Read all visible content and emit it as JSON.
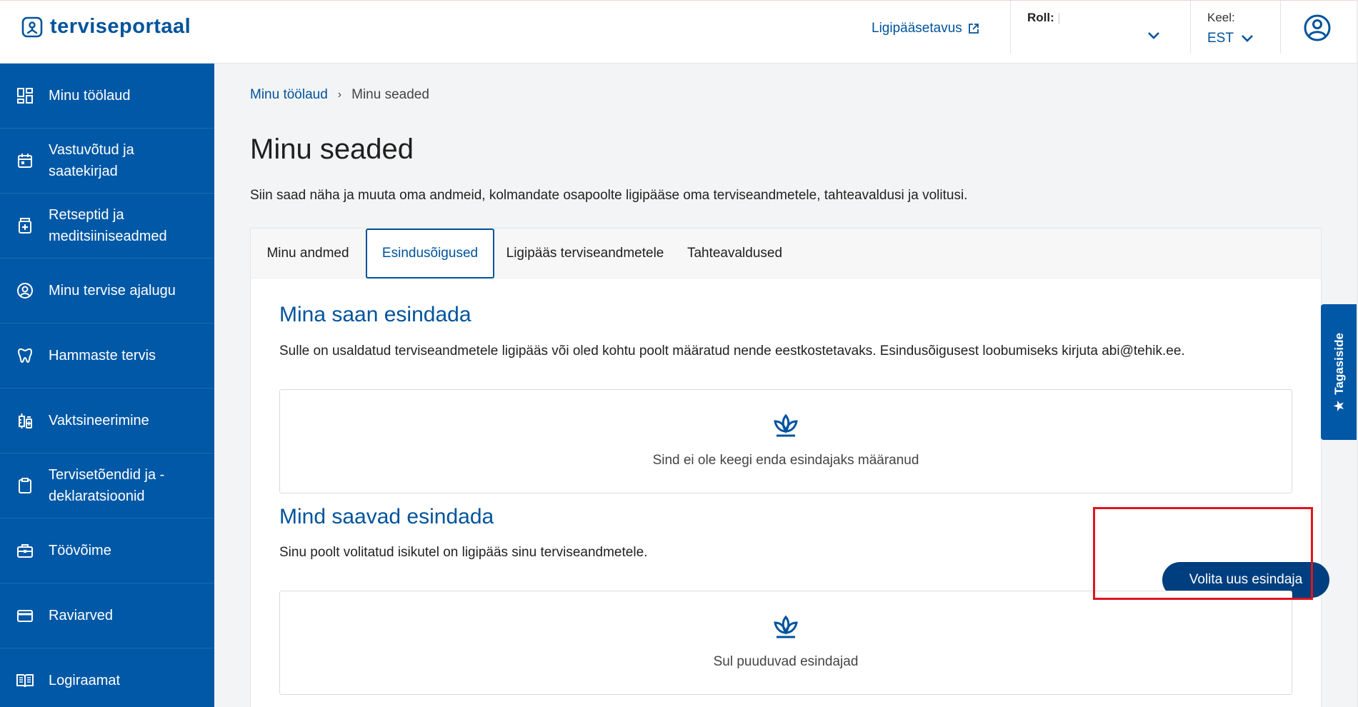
{
  "header": {
    "brand": "terviseportaal",
    "accessibility_link": "Ligipääsetavus",
    "role_label": "Roll:",
    "language_label": "Keel:",
    "language_value": "EST"
  },
  "sidebar": {
    "items": [
      {
        "label": "Minu töölaud",
        "icon": "dashboard-icon"
      },
      {
        "label": "Vastuvõtud ja saatekirjad",
        "icon": "calendar-icon"
      },
      {
        "label": "Retseptid ja meditsiiniseadmed",
        "icon": "prescription-icon"
      },
      {
        "label": "Minu tervise ajalugu",
        "icon": "person-circle-icon"
      },
      {
        "label": "Hammaste tervis",
        "icon": "tooth-icon"
      },
      {
        "label": "Vaktsineerimine",
        "icon": "vaccine-icon"
      },
      {
        "label": "Tervisetõendid ja -deklaratsioonid",
        "icon": "clipboard-icon"
      },
      {
        "label": "Töövõime",
        "icon": "briefcase-icon"
      },
      {
        "label": "Raviarved",
        "icon": "card-icon"
      },
      {
        "label": "Logiraamat",
        "icon": "book-icon"
      }
    ]
  },
  "breadcrumb": {
    "home": "Minu töölaud",
    "separator": "›",
    "current": "Minu seaded"
  },
  "page": {
    "title": "Minu seaded",
    "intro": "Siin saad näha ja muuta oma andmeid, kolmandate osapoolte ligipääse oma terviseandmetele, tahteavaldusi ja volitusi."
  },
  "tabs": [
    {
      "label": "Minu andmed",
      "active": false
    },
    {
      "label": "Esindusõigused",
      "active": true
    },
    {
      "label": "Ligipääs terviseandmetele",
      "active": false
    },
    {
      "label": "Tahteavaldused",
      "active": false
    }
  ],
  "section1": {
    "title": "Mina saan esindada",
    "text": "Sulle on usaldatud terviseandmetele ligipääs või oled kohtu poolt määratud nende eestkostetavaks. Esindusõigusest loobumiseks kirjuta abi@tehik.ee.",
    "empty_message": "Sind ei ole keegi enda esindajaks määranud"
  },
  "section2": {
    "title": "Mind saavad esindada",
    "text": "Sinu poolt volitatud isikutel on ligipääs sinu terviseandmetele.",
    "button": "Volita uus esindaja",
    "empty_message": "Sul puuduvad esindajad"
  },
  "feedback": {
    "label": "Tagasiside",
    "icon": "star-icon"
  },
  "colors": {
    "brand": "#00539c",
    "sidebar": "#0058a6",
    "button": "#003f7f",
    "highlight": "#e0141e"
  }
}
